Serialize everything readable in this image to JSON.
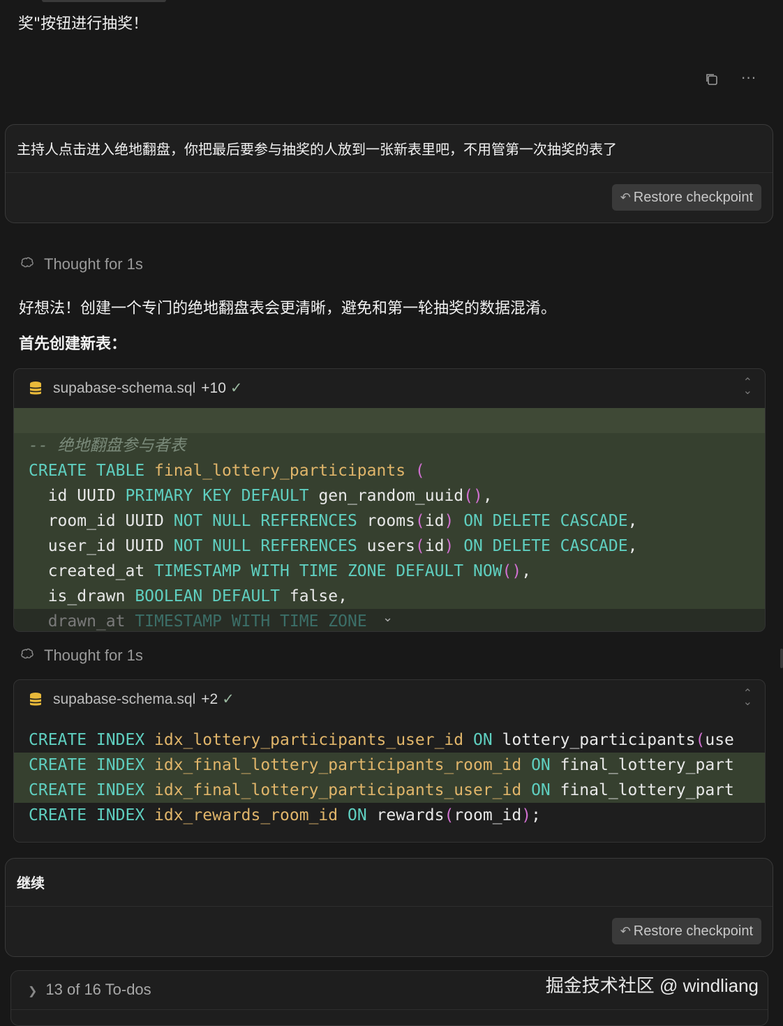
{
  "top": {
    "text": "奖\"按钮进行抽奖！"
  },
  "actions": {
    "copy_icon": "copy-icon",
    "more_icon": "more-icon",
    "more_label": "···"
  },
  "user_message_1": {
    "text": "主持人点击进入绝地翻盘，你把最后要参与抽奖的人放到一张新表里吧，不用管第一次抽奖的表了",
    "restore_label": "Restore checkpoint"
  },
  "thought_1": {
    "label": "Thought for 1s"
  },
  "reply": {
    "line1": "好想法！创建一个专门的绝地翻盘表会更清晰，避免和第一轮抽奖的数据混淆。",
    "line2": "首先创建新表："
  },
  "code_1": {
    "filename": "supabase-schema.sql",
    "diff": "+10",
    "check": "✓",
    "lines": [
      {
        "segments": [
          {
            "t": "",
            "c": "tx"
          }
        ],
        "style": "add-light"
      },
      {
        "segments": [
          {
            "t": "-- 绝地翻盘参与者表",
            "c": "cm"
          }
        ],
        "style": "add"
      },
      {
        "segments": [
          {
            "t": "CREATE TABLE ",
            "c": "kw"
          },
          {
            "t": "final_lottery_participants ",
            "c": "fn"
          },
          {
            "t": "(",
            "c": "pn"
          }
        ],
        "style": "add"
      },
      {
        "segments": [
          {
            "t": "  id UUID ",
            "c": "tx"
          },
          {
            "t": "PRIMARY KEY DEFAULT ",
            "c": "kw"
          },
          {
            "t": "gen_random_uuid",
            "c": "tx"
          },
          {
            "t": "()",
            "c": "pn"
          },
          {
            "t": ",",
            "c": "tx"
          }
        ],
        "style": "add"
      },
      {
        "segments": [
          {
            "t": "  room_id UUID ",
            "c": "tx"
          },
          {
            "t": "NOT NULL REFERENCES ",
            "c": "kw"
          },
          {
            "t": "rooms",
            "c": "tx"
          },
          {
            "t": "(",
            "c": "pn"
          },
          {
            "t": "id",
            "c": "tx"
          },
          {
            "t": ") ",
            "c": "pn"
          },
          {
            "t": "ON DELETE CASCADE",
            "c": "kw"
          },
          {
            "t": ",",
            "c": "tx"
          }
        ],
        "style": "add"
      },
      {
        "segments": [
          {
            "t": "  user_id UUID ",
            "c": "tx"
          },
          {
            "t": "NOT NULL REFERENCES ",
            "c": "kw"
          },
          {
            "t": "users",
            "c": "tx"
          },
          {
            "t": "(",
            "c": "pn"
          },
          {
            "t": "id",
            "c": "tx"
          },
          {
            "t": ") ",
            "c": "pn"
          },
          {
            "t": "ON DELETE CASCADE",
            "c": "kw"
          },
          {
            "t": ",",
            "c": "tx"
          }
        ],
        "style": "add"
      },
      {
        "segments": [
          {
            "t": "  created_at ",
            "c": "tx"
          },
          {
            "t": "TIMESTAMP WITH TIME ZONE DEFAULT NOW",
            "c": "kw"
          },
          {
            "t": "()",
            "c": "pn"
          },
          {
            "t": ",",
            "c": "tx"
          }
        ],
        "style": "add"
      },
      {
        "segments": [
          {
            "t": "  is_drawn ",
            "c": "tx"
          },
          {
            "t": "BOOLEAN DEFAULT ",
            "c": "kw"
          },
          {
            "t": "false,",
            "c": "tx"
          }
        ],
        "style": "add"
      },
      {
        "segments": [
          {
            "t": "  drawn_at ",
            "c": "tx"
          },
          {
            "t": "TIMESTAMP WITH TIME ZONE",
            "c": "kw"
          }
        ],
        "style": "add fade"
      }
    ]
  },
  "thought_2": {
    "label": "Thought for 1s"
  },
  "code_2": {
    "filename": "supabase-schema.sql",
    "diff": "+2",
    "check": "✓",
    "lines": [
      {
        "segments": [
          {
            "t": "CREATE INDEX ",
            "c": "kw"
          },
          {
            "t": "idx_lottery_participants_user_id ",
            "c": "fn"
          },
          {
            "t": "ON ",
            "c": "kw"
          },
          {
            "t": "lottery_participants",
            "c": "tx"
          },
          {
            "t": "(",
            "c": "pn"
          },
          {
            "t": "use",
            "c": "tx"
          }
        ],
        "style": ""
      },
      {
        "segments": [
          {
            "t": "CREATE INDEX ",
            "c": "kw"
          },
          {
            "t": "idx_final_lottery_participants_room_id ",
            "c": "fn"
          },
          {
            "t": "ON ",
            "c": "kw"
          },
          {
            "t": "final_lottery_part",
            "c": "tx"
          }
        ],
        "style": "add"
      },
      {
        "segments": [
          {
            "t": "CREATE INDEX ",
            "c": "kw"
          },
          {
            "t": "idx_final_lottery_participants_user_id ",
            "c": "fn"
          },
          {
            "t": "ON ",
            "c": "kw"
          },
          {
            "t": "final_lottery_part",
            "c": "tx"
          }
        ],
        "style": "add"
      },
      {
        "segments": [
          {
            "t": "CREATE INDEX ",
            "c": "kw"
          },
          {
            "t": "idx_rewards_room_id ",
            "c": "fn"
          },
          {
            "t": "ON ",
            "c": "kw"
          },
          {
            "t": "rewards",
            "c": "tx"
          },
          {
            "t": "(",
            "c": "pn"
          },
          {
            "t": "room_id",
            "c": "tx"
          },
          {
            "t": ")",
            "c": "pn"
          },
          {
            "t": ";",
            "c": "tx"
          }
        ],
        "style": ""
      }
    ]
  },
  "user_message_2": {
    "text": "继续",
    "restore_label": "Restore checkpoint"
  },
  "todos": {
    "label": "13 of 16 To-dos"
  },
  "watermark": {
    "text": "掘金技术社区 @ windliang"
  }
}
